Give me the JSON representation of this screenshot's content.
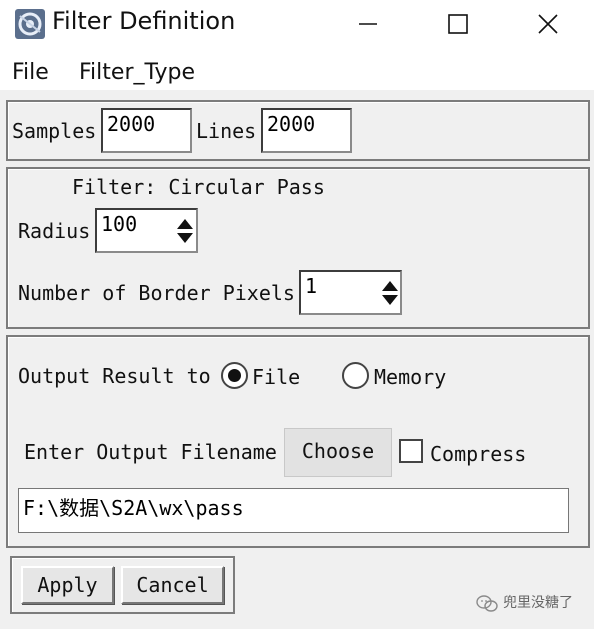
{
  "window": {
    "title": "Filter Definition",
    "controls": {
      "minimize": "minimize",
      "maximize": "maximize",
      "close": "close"
    }
  },
  "menubar": {
    "items": [
      "File",
      "Filter_Type"
    ]
  },
  "dimensions": {
    "samples_label": "Samples",
    "samples_value": "2000",
    "lines_label": "Lines",
    "lines_value": "2000"
  },
  "filter": {
    "title": "Filter: Circular Pass",
    "radius_label": "Radius",
    "radius_value": "100",
    "border_label": "Number of Border Pixels",
    "border_value": "1"
  },
  "output": {
    "result_label": "Output Result to",
    "option_file": "File",
    "option_memory": "Memory",
    "selected": "File",
    "filename_label": "Enter Output Filename",
    "choose_label": "Choose",
    "compress_label": "Compress",
    "compress_checked": false,
    "filename_value": "F:\\数据\\S2A\\wx\\pass"
  },
  "actions": {
    "apply_label": "Apply",
    "cancel_label": "Cancel"
  },
  "watermark": {
    "text": "兜里没糖了",
    "icon": "wechat-icon"
  },
  "colors": {
    "background": "#f0f0f0",
    "titlebar": "#ffffff",
    "field": "#ffffff"
  }
}
